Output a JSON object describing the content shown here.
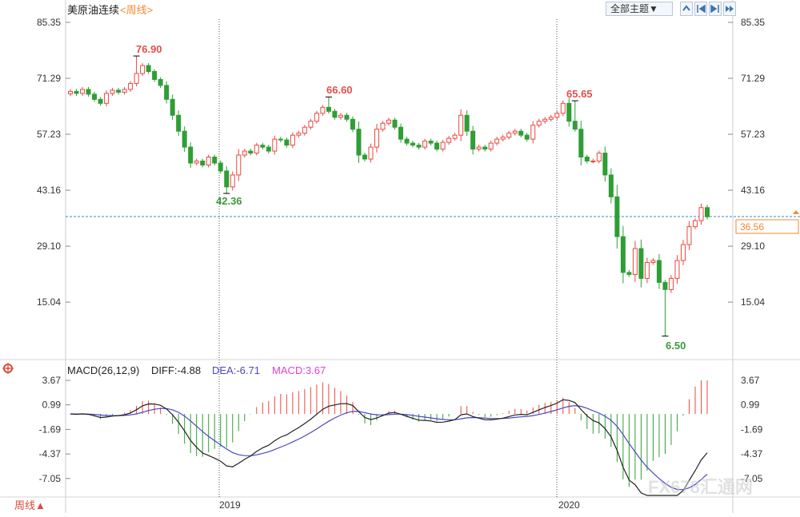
{
  "chart_data": [
    {
      "type": "candlestick",
      "title": "美原油连续",
      "period": "<周线>",
      "ylim": [
        1.0,
        85.35
      ],
      "yticks": [
        "85.35",
        "71.29",
        "57.23",
        "43.16",
        "29.10",
        "15.04"
      ],
      "xticks": [
        "2019",
        "2020"
      ],
      "current_price": "36.56",
      "annotations": {
        "high1": "76.90",
        "low1": "42.36",
        "high2": "66.60",
        "high3": "65.65",
        "low2": "6.50"
      },
      "closes": [
        68,
        67.5,
        68.5,
        67.3,
        66,
        65,
        67.5,
        68.3,
        67.8,
        68.5,
        70,
        72.5,
        74.5,
        73,
        71,
        69.5,
        66,
        62,
        58,
        54,
        50,
        50.5,
        49.5,
        51.5,
        50,
        48,
        44,
        47,
        52,
        53,
        52.5,
        54.5,
        54,
        53,
        56,
        55.8,
        54.5,
        57,
        57.5,
        59,
        60.5,
        62.5,
        64,
        63,
        61.5,
        62,
        61,
        58.5,
        52,
        51,
        54,
        58.5,
        60,
        60.8,
        59,
        56,
        55,
        54.5,
        54,
        55.5,
        55,
        53.5,
        55.2,
        56.2,
        57,
        62,
        58,
        53.5,
        54,
        53.5,
        55,
        56,
        56.5,
        57.5,
        58,
        57,
        56,
        59.5,
        60.5,
        61,
        61.5,
        62.5,
        65,
        60.5,
        58.5,
        51.5,
        50.5,
        50.5,
        52.5,
        47,
        41.5,
        31.5,
        22.5,
        22,
        28.5,
        21,
        25,
        25.5,
        20,
        18.2,
        21,
        25.5,
        29.5,
        34,
        35.5,
        38.8,
        36.5
      ],
      "macd_params": "MACD(26,12,9)",
      "macd_yticks": [
        "3.67",
        "0.99",
        "-1.69",
        "-4.37",
        "-7.05"
      ],
      "macd_ylim": [
        -8.9,
        3.67
      ],
      "diff_label": "DIFF:-4.88",
      "dea_label": "DEA:-6.71",
      "macd_label": "MACD:3.67",
      "colors": {
        "up": "#e8493f",
        "down": "#2f9e35",
        "diff": "#222222",
        "dea": "#4747c9",
        "macd_text": "#e33fd6",
        "price_line": "#2c8dd6",
        "price_box": "#f08a2e"
      }
    }
  ],
  "toolbar": {
    "theme_button": "全部主题▼",
    "status_label": "周线▲"
  },
  "watermark": "FX678汇通网"
}
